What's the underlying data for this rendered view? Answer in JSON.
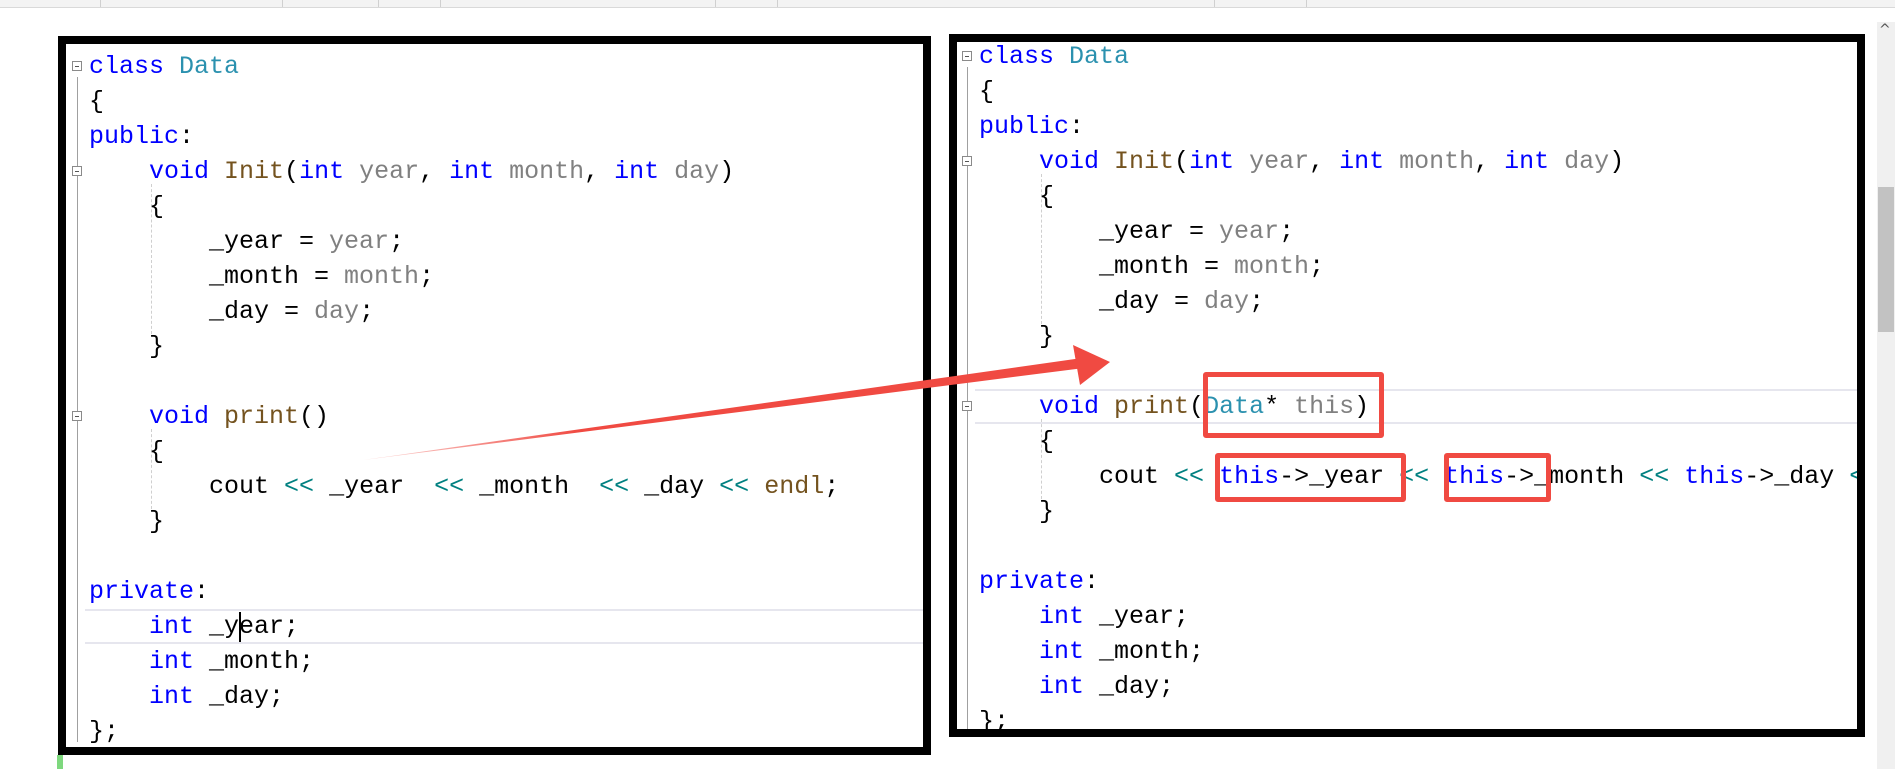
{
  "colors": {
    "keyword": "#0000ff",
    "type": "#2b91af",
    "function": "#74531f",
    "parameter": "#808080",
    "operator": "#008080",
    "highlight_box": "#f04a42",
    "arrow": "#f04a42"
  },
  "left_code": [
    [
      [
        "kw",
        "class "
      ],
      [
        "ty",
        "Data"
      ]
    ],
    [
      [
        "pl",
        "{"
      ]
    ],
    [
      [
        "kw",
        "public"
      ],
      [
        "pl",
        ":"
      ]
    ],
    [
      [
        "pl",
        "    "
      ],
      [
        "kw",
        "void "
      ],
      [
        "fn",
        "Init"
      ],
      [
        "pl",
        "("
      ],
      [
        "kw",
        "int "
      ],
      [
        "pa",
        "year"
      ],
      [
        "pl",
        ", "
      ],
      [
        "kw",
        "int "
      ],
      [
        "pa",
        "month"
      ],
      [
        "pl",
        ", "
      ],
      [
        "kw",
        "int "
      ],
      [
        "pa",
        "day"
      ],
      [
        "pl",
        ")"
      ]
    ],
    [
      [
        "pl",
        "    {"
      ]
    ],
    [
      [
        "pl",
        "        _year = "
      ],
      [
        "pa",
        "year"
      ],
      [
        "pl",
        ";"
      ]
    ],
    [
      [
        "pl",
        "        _month = "
      ],
      [
        "pa",
        "month"
      ],
      [
        "pl",
        ";"
      ]
    ],
    [
      [
        "pl",
        "        _day = "
      ],
      [
        "pa",
        "day"
      ],
      [
        "pl",
        ";"
      ]
    ],
    [
      [
        "pl",
        "    }"
      ]
    ],
    [
      [
        "pl",
        ""
      ]
    ],
    [
      [
        "pl",
        "    "
      ],
      [
        "kw",
        "void "
      ],
      [
        "fn",
        "print"
      ],
      [
        "pl",
        "()"
      ]
    ],
    [
      [
        "pl",
        "    {"
      ]
    ],
    [
      [
        "pl",
        "        cout "
      ],
      [
        "op",
        "<<"
      ],
      [
        "pl",
        " _year  "
      ],
      [
        "op",
        "<<"
      ],
      [
        "pl",
        " _month  "
      ],
      [
        "op",
        "<<"
      ],
      [
        "pl",
        " _day "
      ],
      [
        "op",
        "<<"
      ],
      [
        "pl",
        " "
      ],
      [
        "fn",
        "endl"
      ],
      [
        "pl",
        ";"
      ]
    ],
    [
      [
        "pl",
        "    }"
      ]
    ],
    [
      [
        "pl",
        ""
      ]
    ],
    [
      [
        "kw",
        "private"
      ],
      [
        "pl",
        ":"
      ]
    ],
    [
      [
        "pl",
        "    "
      ],
      [
        "kw",
        "int"
      ],
      [
        "pl",
        " _year;"
      ]
    ],
    [
      [
        "pl",
        "    "
      ],
      [
        "kw",
        "int"
      ],
      [
        "pl",
        " _month;"
      ]
    ],
    [
      [
        "pl",
        "    "
      ],
      [
        "kw",
        "int"
      ],
      [
        "pl",
        " _day;"
      ]
    ],
    [
      [
        "pl",
        "};"
      ]
    ]
  ],
  "right_code": [
    [
      [
        "kw",
        "class "
      ],
      [
        "ty",
        "Data"
      ]
    ],
    [
      [
        "pl",
        "{"
      ]
    ],
    [
      [
        "kw",
        "public"
      ],
      [
        "pl",
        ":"
      ]
    ],
    [
      [
        "pl",
        "    "
      ],
      [
        "kw",
        "void "
      ],
      [
        "fn",
        "Init"
      ],
      [
        "pl",
        "("
      ],
      [
        "kw",
        "int "
      ],
      [
        "pa",
        "year"
      ],
      [
        "pl",
        ", "
      ],
      [
        "kw",
        "int "
      ],
      [
        "pa",
        "month"
      ],
      [
        "pl",
        ", "
      ],
      [
        "kw",
        "int "
      ],
      [
        "pa",
        "day"
      ],
      [
        "pl",
        ")"
      ]
    ],
    [
      [
        "pl",
        "    {"
      ]
    ],
    [
      [
        "pl",
        "        _year = "
      ],
      [
        "pa",
        "year"
      ],
      [
        "pl",
        ";"
      ]
    ],
    [
      [
        "pl",
        "        _month = "
      ],
      [
        "pa",
        "month"
      ],
      [
        "pl",
        ";"
      ]
    ],
    [
      [
        "pl",
        "        _day = "
      ],
      [
        "pa",
        "day"
      ],
      [
        "pl",
        ";"
      ]
    ],
    [
      [
        "pl",
        "    }"
      ]
    ],
    [
      [
        "pl",
        ""
      ]
    ],
    [
      [
        "pl",
        "    "
      ],
      [
        "kw",
        "void "
      ],
      [
        "fn",
        "print"
      ],
      [
        "pl",
        "("
      ],
      [
        "ty",
        "Data"
      ],
      [
        "pl",
        "* "
      ],
      [
        "pa",
        "this"
      ],
      [
        "pl",
        ")"
      ]
    ],
    [
      [
        "pl",
        "    {"
      ]
    ],
    [
      [
        "pl",
        "        cout "
      ],
      [
        "op",
        "<<"
      ],
      [
        "pl",
        " "
      ],
      [
        "kw",
        "this"
      ],
      [
        "pl",
        "->_year "
      ],
      [
        "op",
        "<<"
      ],
      [
        "pl",
        " "
      ],
      [
        "kw",
        "this"
      ],
      [
        "pl",
        "->_month "
      ],
      [
        "op",
        "<<"
      ],
      [
        "pl",
        " "
      ],
      [
        "kw",
        "this"
      ],
      [
        "pl",
        "->_day "
      ],
      [
        "op",
        "<<"
      ]
    ],
    [
      [
        "pl",
        "    }"
      ]
    ],
    [
      [
        "pl",
        ""
      ]
    ],
    [
      [
        "kw",
        "private"
      ],
      [
        "pl",
        ":"
      ]
    ],
    [
      [
        "pl",
        "    "
      ],
      [
        "kw",
        "int"
      ],
      [
        "pl",
        " _year;"
      ]
    ],
    [
      [
        "pl",
        "    "
      ],
      [
        "kw",
        "int"
      ],
      [
        "pl",
        " _month;"
      ]
    ],
    [
      [
        "pl",
        "    "
      ],
      [
        "kw",
        "int"
      ],
      [
        "pl",
        " _day;"
      ]
    ],
    [
      [
        "pl",
        "};"
      ]
    ]
  ]
}
